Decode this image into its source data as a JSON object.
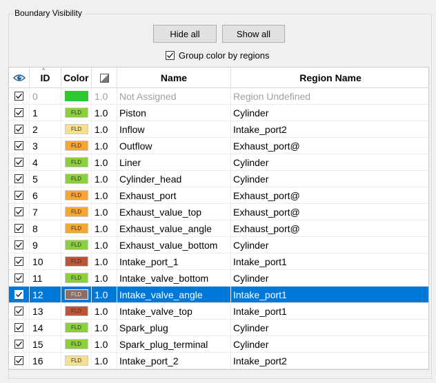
{
  "group": {
    "title": "Boundary Visibility"
  },
  "buttons": {
    "hide_all": "Hide all",
    "show_all": "Show all"
  },
  "group_color": {
    "label": "Group color by regions",
    "checked": true
  },
  "table": {
    "headers": {
      "id": "ID",
      "color": "Color",
      "name": "Name",
      "region": "Region Name"
    },
    "sort_indicator": "^",
    "rows": [
      {
        "visible": true,
        "id": "0",
        "color": "#2fc62f",
        "color_text": "",
        "alpha": "1.0",
        "name": "Not Assigned",
        "region": "Region Undefined",
        "state": "disabled"
      },
      {
        "visible": true,
        "id": "1",
        "color": "#8ccf3c",
        "color_text": "FLD",
        "alpha": "1.0",
        "name": "Piston",
        "region": "Cylinder",
        "state": "normal"
      },
      {
        "visible": true,
        "id": "2",
        "color": "#f4e08e",
        "color_text": "FLD",
        "alpha": "1.0",
        "name": "Inflow",
        "region": "Intake_port2",
        "state": "normal"
      },
      {
        "visible": true,
        "id": "3",
        "color": "#f6a531",
        "color_text": "FLD",
        "alpha": "1.0",
        "name": "Outflow",
        "region": "Exhaust_port@",
        "state": "normal"
      },
      {
        "visible": true,
        "id": "4",
        "color": "#8ccf3c",
        "color_text": "FLD",
        "alpha": "1.0",
        "name": "Liner",
        "region": "Cylinder",
        "state": "normal"
      },
      {
        "visible": true,
        "id": "5",
        "color": "#8ccf3c",
        "color_text": "FLD",
        "alpha": "1.0",
        "name": "Cylinder_head",
        "region": "Cylinder",
        "state": "normal"
      },
      {
        "visible": true,
        "id": "6",
        "color": "#f6a531",
        "color_text": "FLD",
        "alpha": "1.0",
        "name": "Exhaust_port",
        "region": "Exhaust_port@",
        "state": "normal"
      },
      {
        "visible": true,
        "id": "7",
        "color": "#f6a531",
        "color_text": "FLD",
        "alpha": "1.0",
        "name": "Exhaust_value_top",
        "region": "Exhaust_port@",
        "state": "normal"
      },
      {
        "visible": true,
        "id": "8",
        "color": "#f6a531",
        "color_text": "FLD",
        "alpha": "1.0",
        "name": "Exhaust_value_angle",
        "region": "Exhaust_port@",
        "state": "normal"
      },
      {
        "visible": true,
        "id": "9",
        "color": "#8ccf3c",
        "color_text": "FLD",
        "alpha": "1.0",
        "name": "Exhaust_value_bottom",
        "region": "Cylinder",
        "state": "normal"
      },
      {
        "visible": true,
        "id": "10",
        "color": "#b9563a",
        "color_text": "FLD",
        "alpha": "1.0",
        "name": "Intake_port_1",
        "region": "Intake_port1",
        "state": "normal"
      },
      {
        "visible": true,
        "id": "11",
        "color": "#8ccf3c",
        "color_text": "FLD",
        "alpha": "1.0",
        "name": "Intake_valve_bottom",
        "region": "Cylinder",
        "state": "normal"
      },
      {
        "visible": true,
        "id": "12",
        "color": "#8a6e68",
        "color_text": "FLD",
        "alpha": "1.0",
        "name": "Intake_valve_angle",
        "region": "Intake_port1",
        "state": "selected"
      },
      {
        "visible": true,
        "id": "13",
        "color": "#b9563a",
        "color_text": "FLD",
        "alpha": "1.0",
        "name": "Intake_valve_top",
        "region": "Intake_port1",
        "state": "normal"
      },
      {
        "visible": true,
        "id": "14",
        "color": "#8ccf3c",
        "color_text": "FLD",
        "alpha": "1.0",
        "name": "Spark_plug",
        "region": "Cylinder",
        "state": "normal"
      },
      {
        "visible": true,
        "id": "15",
        "color": "#8ccf3c",
        "color_text": "FLD",
        "alpha": "1.0",
        "name": "Spark_plug_terminal",
        "region": "Cylinder",
        "state": "normal"
      },
      {
        "visible": true,
        "id": "16",
        "color": "#f4e08e",
        "color_text": "FLD",
        "alpha": "1.0",
        "name": "Intake_port_2",
        "region": "Intake_port2",
        "state": "normal"
      }
    ]
  },
  "icons": {
    "eye": "eye-icon",
    "alpha": "transparency-icon",
    "check": "checkmark-icon"
  }
}
